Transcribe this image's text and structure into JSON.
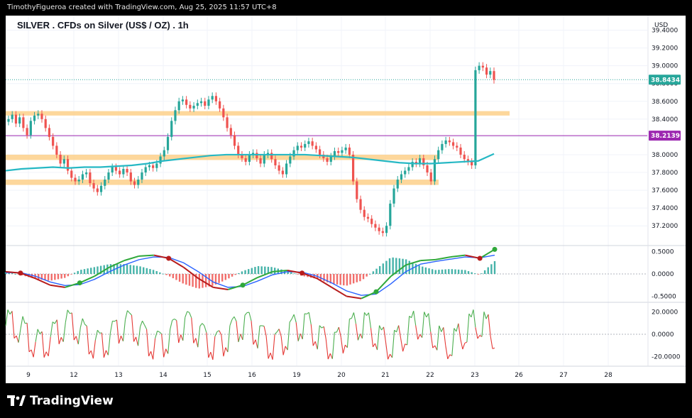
{
  "attribution": "TimothyFigueroa created with TradingView.com, Aug 25, 2025 11:57 UTC+8",
  "brand": {
    "name": "TradingView",
    "icon": "tradingview-logo-icon"
  },
  "chart_data": [
    {
      "type": "line",
      "title": "SILVER . CFDs on Silver (US$ / OZ) . 1h",
      "ylabel": "USD",
      "ylim": [
        37.05,
        39.5
      ],
      "yticks": [
        "39.4000",
        "39.2000",
        "39.0000",
        "38.8000",
        "38.6000",
        "38.4000",
        "38.2000",
        "38.0000",
        "37.8000",
        "37.6000",
        "37.4000",
        "37.2000"
      ],
      "x": [
        "9",
        "12",
        "13",
        "14",
        "15",
        "16",
        "19",
        "20",
        "21",
        "22",
        "23",
        "26",
        "27",
        "28"
      ],
      "grid": true,
      "series": [
        {
          "kind": "candles",
          "values": [
            38.4,
            38.45,
            38.35,
            38.42,
            38.3,
            38.22,
            38.38,
            38.44,
            38.46,
            38.4,
            38.3,
            38.2,
            38.1,
            38.0,
            37.9,
            37.95,
            37.82,
            37.74,
            37.7,
            37.72,
            37.78,
            37.8,
            37.68,
            37.62,
            37.58,
            37.65,
            37.72,
            37.8,
            37.86,
            37.82,
            37.78,
            37.84,
            37.8,
            37.7,
            37.66,
            37.72,
            37.8,
            37.86,
            37.88,
            37.85,
            37.9,
            37.98,
            38.05,
            38.2,
            38.38,
            38.5,
            38.6,
            38.62,
            38.56,
            38.52,
            38.55,
            38.58,
            38.6,
            38.55,
            38.62,
            38.66,
            38.6,
            38.52,
            38.42,
            38.3,
            38.22,
            38.1,
            38.0,
            37.96,
            37.92,
            38.0,
            38.02,
            37.96,
            37.9,
            38.0,
            38.02,
            37.95,
            37.88,
            37.82,
            37.78,
            37.9,
            37.98,
            38.05,
            38.1,
            38.08,
            38.12,
            38.15,
            38.1,
            38.06,
            38.0,
            37.96,
            37.92,
            37.98,
            38.04,
            38.02,
            38.05,
            38.08,
            38.0,
            37.7,
            37.5,
            37.38,
            37.3,
            37.28,
            37.22,
            37.18,
            37.14,
            37.12,
            37.2,
            37.45,
            37.62,
            37.72,
            37.78,
            37.82,
            37.86,
            37.92,
            37.9,
            37.96,
            37.88,
            37.8,
            37.7,
            37.95,
            38.05,
            38.12,
            38.16,
            38.14,
            38.1,
            38.08,
            38.0,
            37.95,
            37.92,
            37.88,
            38.95,
            39.0,
            38.98,
            38.9,
            38.94,
            38.84
          ]
        },
        {
          "name": "moving-average",
          "color": "#26b8c4",
          "values": [
            37.82,
            37.84,
            37.85,
            37.86,
            37.85,
            37.86,
            37.86,
            37.87,
            37.88,
            37.9,
            37.93,
            37.95,
            37.97,
            37.99,
            38.0,
            38.0,
            38.0,
            38.0,
            38.0,
            38.0,
            37.99,
            37.98,
            37.97,
            37.95,
            37.93,
            37.91,
            37.9,
            37.9,
            37.91,
            37.92,
            37.93,
            38.01
          ]
        },
        {
          "name": "current-price",
          "value": 38.8434,
          "color": "#26a69a"
        },
        {
          "name": "horizontal-level",
          "value": 38.2139,
          "color": "#9c27b0"
        }
      ],
      "zones": [
        {
          "from": 38.44,
          "to": 38.49
        },
        {
          "from": 37.94,
          "to": 38.0
        },
        {
          "from": 37.66,
          "to": 37.72
        }
      ],
      "price_labels": [
        "38.8434",
        "38.2139"
      ],
      "unit": "USD"
    },
    {
      "type": "line",
      "title": "",
      "ylim": [
        -0.62,
        0.62
      ],
      "yticks": [
        "0.5000",
        "0.0000",
        "-0.5000"
      ],
      "series": [
        {
          "name": "oscillator-line",
          "color": "#2fa83a",
          "values": [
            0.05,
            0.02,
            -0.1,
            -0.25,
            -0.3,
            -0.2,
            -0.05,
            0.15,
            0.3,
            0.4,
            0.42,
            0.35,
            0.15,
            -0.1,
            -0.3,
            -0.35,
            -0.25,
            -0.08,
            0.05,
            0.08,
            0.02,
            -0.1,
            -0.3,
            -0.5,
            -0.55,
            -0.4,
            -0.05,
            0.2,
            0.3,
            0.32,
            0.38,
            0.42,
            0.35,
            0.55
          ]
        },
        {
          "name": "signal-line",
          "color": "#2962ff",
          "values": [
            0.03,
            0.03,
            -0.05,
            -0.18,
            -0.26,
            -0.24,
            -0.12,
            0.05,
            0.2,
            0.32,
            0.38,
            0.37,
            0.25,
            0.05,
            -0.18,
            -0.3,
            -0.28,
            -0.16,
            -0.02,
            0.05,
            0.04,
            -0.05,
            -0.2,
            -0.38,
            -0.48,
            -0.45,
            -0.22,
            0.05,
            0.22,
            0.28,
            0.33,
            0.38,
            0.36,
            0.42
          ]
        },
        {
          "name": "histogram-positive",
          "color": "#26a69a"
        },
        {
          "name": "histogram-negative",
          "color": "#ef5350"
        }
      ]
    },
    {
      "type": "line",
      "title": "",
      "ylim": [
        -28,
        28
      ],
      "yticks": [
        "20.0000",
        "0.0000",
        "-20.0000"
      ],
      "series": [
        {
          "name": "momentum-oscillator",
          "color": "#4caf50",
          "negative_color": "#e53935"
        }
      ]
    }
  ]
}
